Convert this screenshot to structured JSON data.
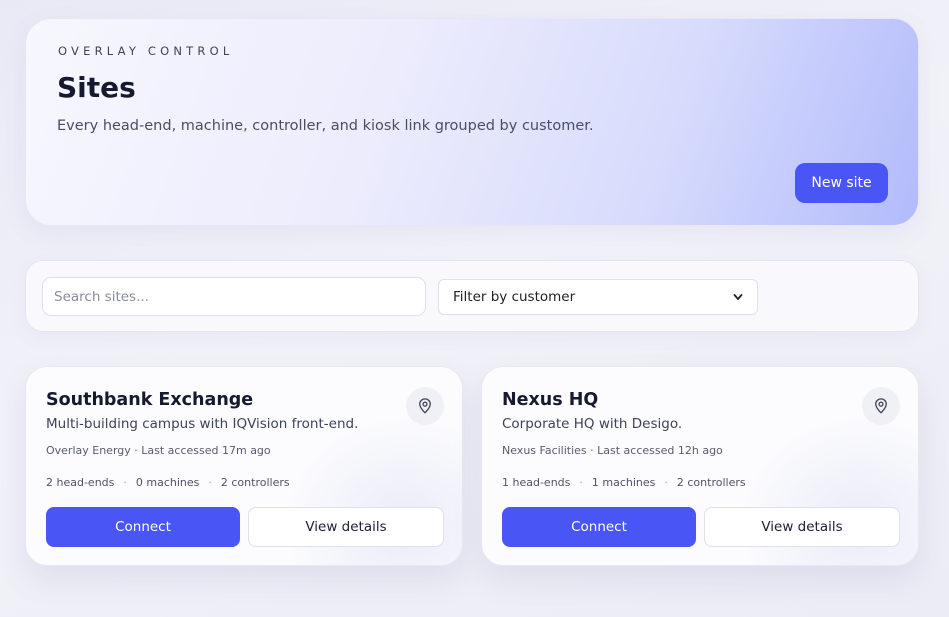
{
  "header": {
    "eyebrow": "OVERLAY CONTROL",
    "title": "Sites",
    "subtitle": "Every head-end, machine, controller, and kiosk link grouped by customer.",
    "new_site_label": "New site"
  },
  "filters": {
    "search_placeholder": "Search sites...",
    "customer_filter_value": "Filter by customer"
  },
  "colors": {
    "accent": "#4a55f5"
  },
  "sites": [
    {
      "name": "Southbank Exchange",
      "description": "Multi-building campus with IQVision front-end.",
      "meta": "Overlay Energy · Last accessed 17m ago",
      "stats": [
        "2 head-ends",
        "0 machines",
        "2 controllers"
      ],
      "connect_label": "Connect",
      "details_label": "View details",
      "icon": "map-pin-icon"
    },
    {
      "name": "Nexus HQ",
      "description": "Corporate HQ with Desigo.",
      "meta": "Nexus Facilities · Last accessed 12h ago",
      "stats": [
        "1 head-ends",
        "1 machines",
        "2 controllers"
      ],
      "connect_label": "Connect",
      "details_label": "View details",
      "icon": "map-pin-icon"
    }
  ]
}
